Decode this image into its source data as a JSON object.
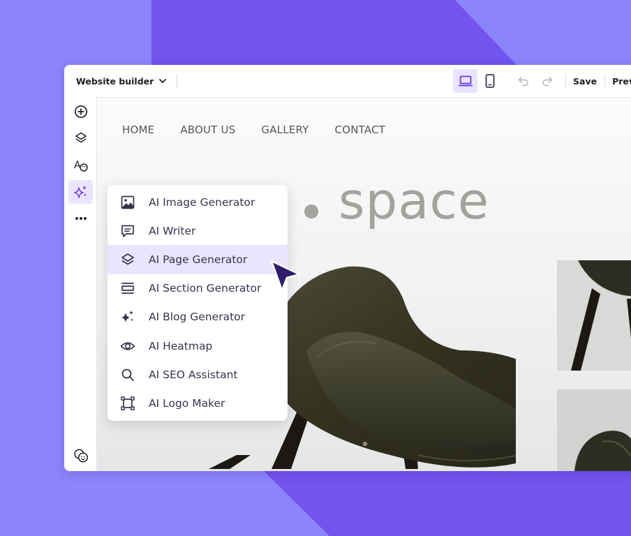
{
  "toolbar": {
    "title": "Website builder",
    "save_label": "Save",
    "preview_label": "Preview"
  },
  "sidebar": {
    "items": [
      {
        "icon": "add-icon"
      },
      {
        "icon": "layers-icon"
      },
      {
        "icon": "styles-icon"
      },
      {
        "icon": "ai-sparkle-icon",
        "active": true
      },
      {
        "icon": "more-icon"
      }
    ],
    "bottom_icon": "faces-icon"
  },
  "site": {
    "nav": [
      "HOME",
      "ABOUT US",
      "GALLERY",
      "CONTACT"
    ],
    "hero_text": "space"
  },
  "ai_menu": {
    "items": [
      {
        "label": "AI Image Generator",
        "icon": "image-icon"
      },
      {
        "label": "AI Writer",
        "icon": "chat-icon"
      },
      {
        "label": "AI Page Generator",
        "icon": "layers-icon",
        "highlighted": true
      },
      {
        "label": "AI Section Generator",
        "icon": "section-icon"
      },
      {
        "label": "AI Blog Generator",
        "icon": "sparkle-icon"
      },
      {
        "label": "AI Heatmap",
        "icon": "eye-icon"
      },
      {
        "label": "AI SEO Assistant",
        "icon": "search-icon"
      },
      {
        "label": "AI Logo Maker",
        "icon": "frame-icon"
      }
    ]
  },
  "colors": {
    "background": "#8c84fb",
    "background_dark": "#7254ef",
    "accent": "#673de6",
    "highlight": "#ebe4ff",
    "cursor": "#2f1c6a",
    "hero_text": "#a3a29c"
  }
}
